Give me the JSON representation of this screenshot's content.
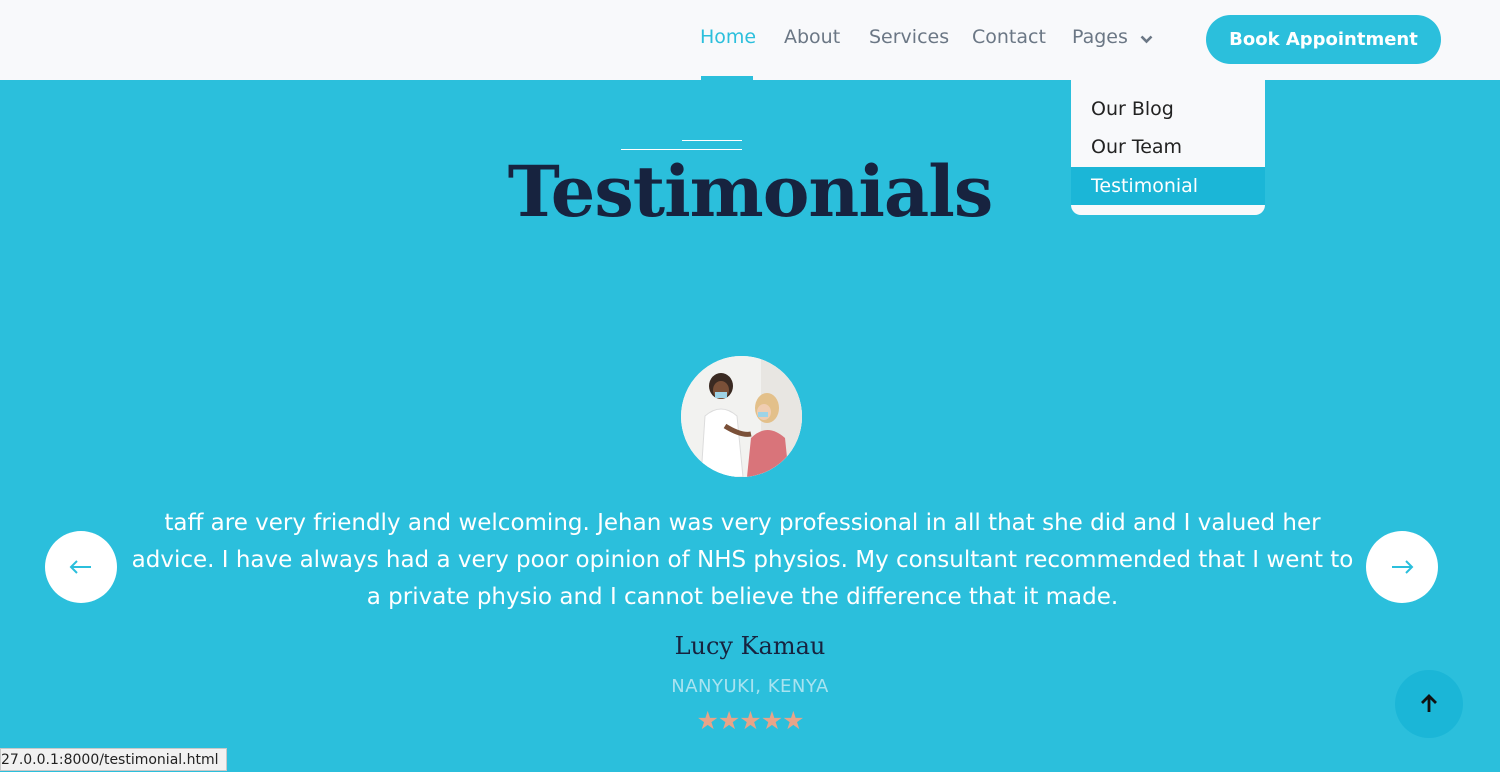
{
  "nav": {
    "items": [
      {
        "label": "Home"
      },
      {
        "label": "About"
      },
      {
        "label": "Services"
      },
      {
        "label": "Contact"
      },
      {
        "label": "Pages"
      }
    ],
    "book_label": "Book Appointment"
  },
  "dropdown": {
    "items": [
      {
        "label": "Our Blog"
      },
      {
        "label": "Our Team"
      },
      {
        "label": "Testimonial"
      }
    ]
  },
  "page": {
    "title": "Testimonials"
  },
  "testimonial": {
    "quote": "taff are very friendly and welcoming. Jehan was very professional in all that she did and I valued her advice. I have always had a very poor opinion of NHS physios. My consultant recommended that I went to a private physio and I cannot believe the difference that it made.",
    "name": "Lucy Kamau",
    "location": "NANYUKI, KENYA",
    "rating": 5,
    "stars": "★★★★★"
  },
  "status_bar": {
    "url": "27.0.0.1:8000/testimonial.html"
  },
  "colors": {
    "accent": "#2bbfdc",
    "title": "#17233f",
    "star": "#e7a489",
    "header_bg": "#f8f9fb"
  }
}
